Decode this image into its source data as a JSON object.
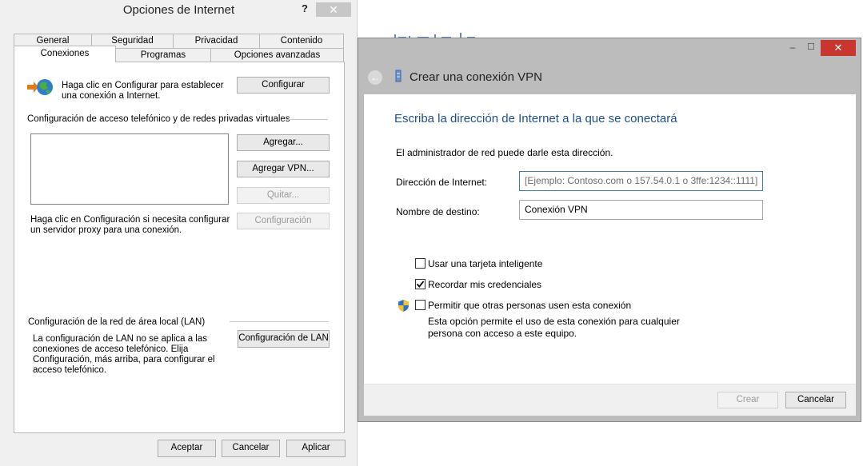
{
  "inet": {
    "title": "Opciones de Internet",
    "help": "?",
    "close": "✕",
    "tabs_row1": [
      "General",
      "Seguridad",
      "Privacidad",
      "Contenido"
    ],
    "tabs_row2": [
      "Conexiones",
      "Programas",
      "Opciones avanzadas"
    ],
    "setup_text_1": "Haga clic en Configurar para establecer",
    "setup_text_2": "una conexión a Internet.",
    "setup_button": "Configurar",
    "dialup_heading": "Configuración de acceso telefónico y de redes privadas virtuales",
    "add_button": "Agregar...",
    "add_vpn_button": "Agregar VPN...",
    "remove_button": "Quitar...",
    "settings_button": "Configuración",
    "proxy_text_1": "Haga clic en Configuración si necesita configurar",
    "proxy_text_2": "un servidor proxy para una conexión.",
    "lan_heading": "Configuración de la red de área local (LAN)",
    "lan_text_1": "La configuración de LAN no se aplica a las",
    "lan_text_2": "conexiones de acceso telefónico. Elija",
    "lan_text_3": "Configuración, más arriba, para configurar el",
    "lan_text_4": "acceso telefónico.",
    "lan_button": "Configuración de LAN",
    "ok_button": "Aceptar",
    "cancel_button": "Cancelar",
    "apply_button": "Aplicar"
  },
  "vpn": {
    "window_title": "Crear una conexión VPN",
    "minimize": "–",
    "maximize": "☐",
    "close": "✕",
    "heading": "Escriba la dirección de Internet a la que se conectará",
    "admin_note": "El administrador de red puede darle esta dirección.",
    "address_label": "Dirección de Internet:",
    "address_value": "[Ejemplo: Contoso.com o 157.54.0.1 o 3ffe:1234::1111]",
    "dest_label": "Nombre de destino:",
    "dest_value": "Conexión VPN",
    "smartcard_label": "Usar una tarjeta inteligente",
    "smartcard_checked": false,
    "remember_label": "Recordar mis credenciales",
    "remember_checked": true,
    "allow_label": "Permitir que otras personas usen esta conexión",
    "allow_checked": false,
    "allow_desc_1": "Esta opción permite el uso de esta conexión para cualquier",
    "allow_desc_2": "persona con acceso a este equipo.",
    "create_button": "Crear",
    "cancel_button": "Cancelar"
  }
}
